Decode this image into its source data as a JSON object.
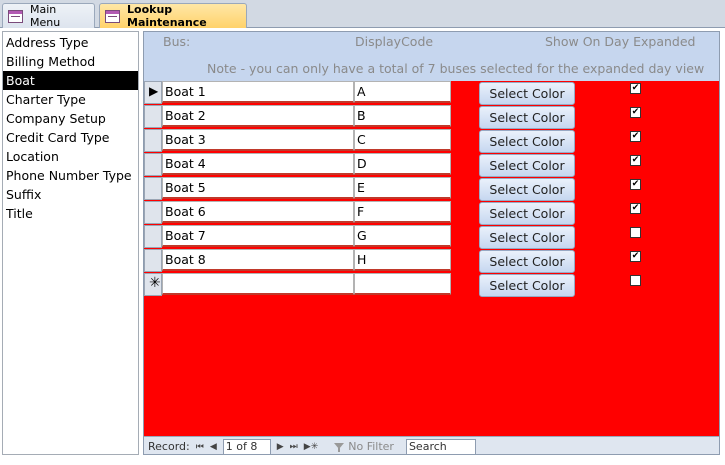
{
  "tabs": [
    {
      "label": "Main Menu"
    },
    {
      "label": "Lookup Maintenance"
    }
  ],
  "lookup_list": [
    "Address Type",
    "Billing Method",
    "Boat",
    "Charter Type",
    "Company Setup",
    "Credit Card Type",
    "Location",
    "Phone Number Type",
    "Suffix",
    "Title"
  ],
  "selected_lookup": "Boat",
  "header": {
    "bus": "Bus:",
    "display_code": "DisplayCode",
    "show_on_day": "Show On Day Expanded",
    "note": "Note - you can only have a total of 7 buses selected for the expanded day view"
  },
  "records": [
    {
      "name": "Boat 1",
      "code": "A",
      "button": "Select Color",
      "checked": true
    },
    {
      "name": "Boat 2",
      "code": "B",
      "button": "Select Color",
      "checked": true
    },
    {
      "name": "Boat 3",
      "code": "C",
      "button": "Select Color",
      "checked": true
    },
    {
      "name": "Boat 4",
      "code": "D",
      "button": "Select Color",
      "checked": true
    },
    {
      "name": "Boat 5",
      "code": "E",
      "button": "Select Color",
      "checked": true
    },
    {
      "name": "Boat 6",
      "code": "F",
      "button": "Select Color",
      "checked": true
    },
    {
      "name": "Boat 7",
      "code": "G",
      "button": "Select Color",
      "checked": false
    },
    {
      "name": "Boat 8",
      "code": "H",
      "button": "Select Color",
      "checked": true
    }
  ],
  "new_record": {
    "name": "",
    "code": "",
    "button": "Select Color",
    "checked": false
  },
  "navigation": {
    "label": "Record:",
    "position": "1 of 8",
    "filter": "No Filter",
    "search": "Search"
  },
  "colors": {
    "form_background": "#ff0000",
    "header_background": "#c6d6ee",
    "active_tab": "#ffd26b",
    "selected_item": "#000000"
  }
}
